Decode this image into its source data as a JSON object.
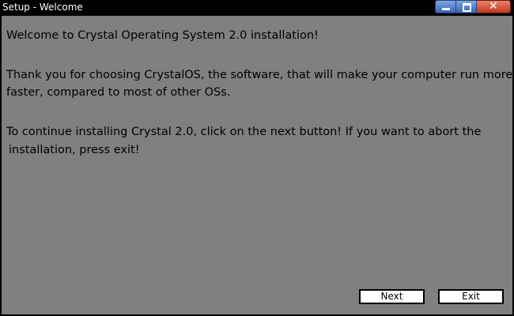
{
  "window": {
    "title": "Setup - Welcome",
    "controls": {
      "minimize": "minimize-icon",
      "maximize": "maximize-icon",
      "close": "close-icon"
    }
  },
  "content": {
    "heading": "Welcome to Crystal Operating System 2.0 installation!",
    "paragraph1_line1": "Thank you for choosing CrystalOS, the software, that will make your computer run more",
    "paragraph1_line2": "faster, compared to most of other OSs.",
    "paragraph2_line1": "To continue installing Crystal 2.0, click on the next button! If you want to abort the",
    "paragraph2_line2": "installation, press exit!"
  },
  "buttons": {
    "next_label": "Next",
    "exit_label": "Exit"
  },
  "colors": {
    "background": "#808080",
    "titlebar": "#000000",
    "title_text": "#ffffff"
  }
}
